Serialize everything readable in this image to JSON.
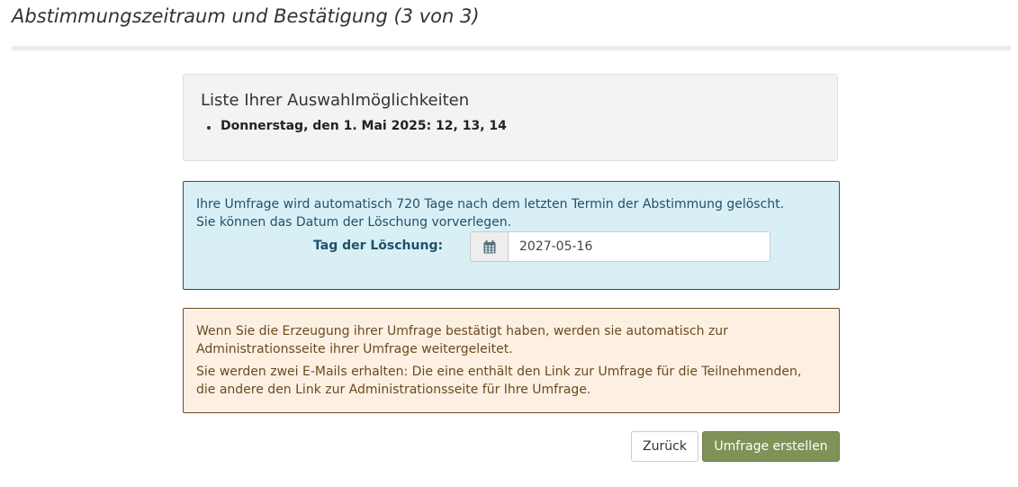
{
  "page": {
    "title": "Abstimmungszeitraum und Bestätigung (3 von 3)"
  },
  "choices": {
    "heading": "Liste Ihrer Auswahlmöglichkeiten",
    "items": [
      "Donnerstag, den 1. Mai 2025: 12, 13, 14"
    ]
  },
  "info": {
    "line1": "Ihre Umfrage wird automatisch 720 Tage nach dem letzten Termin der Abstimmung gelöscht.",
    "line2": "Sie können das Datum der Löschung vorverlegen.",
    "deletion_label": "Tag der Löschung:",
    "deletion_date": "2027-05-16",
    "calendar_icon": "calendar-icon"
  },
  "warning": {
    "p1_line1": "Wenn Sie die Erzeugung ihrer Umfrage bestätigt haben, werden sie automatisch zur",
    "p1_line2": "Administrationsseite ihrer Umfrage weitergeleitet.",
    "p2_line1": "Sie werden zwei E-Mails erhalten: Die eine enthält den Link zur Umfrage für die Teilnehmenden,",
    "p2_line2": "die andere den Link zur Administrationsseite für Ihre Umfrage."
  },
  "actions": {
    "back_label": "Zurück",
    "create_label": "Umfrage erstellen"
  },
  "colors": {
    "accent": "#7f9258",
    "info_bg": "#d9eff6",
    "info_text": "#1f5168",
    "warning_bg": "#fdf0e3",
    "warning_text": "#6b4a1e"
  }
}
